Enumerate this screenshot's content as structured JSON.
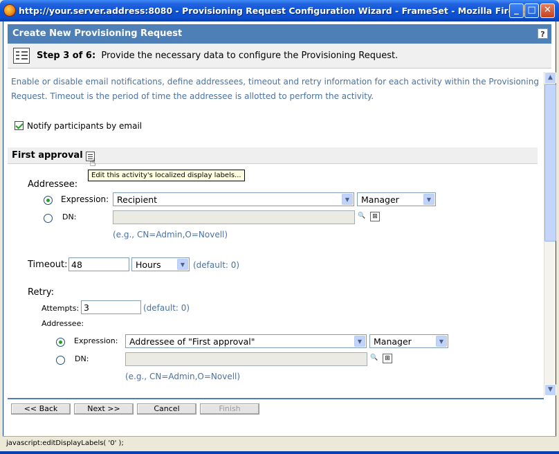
{
  "window": {
    "title": "http://your.server.address:8080 - Provisioning Request Configuration Wizard - FrameSet - Mozilla Firefox",
    "title_host": "http://your.server.address:8080",
    "title_rest": " - Provisioning Request Configuration Wizard - FrameSet - Mozilla Firefox",
    "minimize": "_",
    "maximize": "□",
    "close": "✕"
  },
  "header": {
    "title": "Create New Provisioning Request",
    "help": "?"
  },
  "step": {
    "label": "Step 3 of 6:",
    "text": "Provide the necessary data to configure the Provisioning Request."
  },
  "description": "Enable or disable email notifications, define addressees, timeout and retry information for each activity within the Provisioning Request.  Timeout is the period of time the addressee is allotted to perform the activity.",
  "notify": {
    "label": "Notify participants by email",
    "checked": true
  },
  "activity": {
    "name": "First approval",
    "tooltip": "Edit this activity's localized display labels...",
    "addressee": {
      "heading": "Addressee:",
      "expression_label": "Expression:",
      "expression_value": "Recipient",
      "relationship_value": "Manager",
      "dn_label": "DN:",
      "dn_value": "",
      "hint": "(e.g., CN=Admin,O=Novell)"
    },
    "timeout": {
      "label": "Timeout:",
      "value": "48",
      "unit": "Hours",
      "default": "(default: 0)"
    },
    "retry": {
      "heading": "Retry:",
      "attempts_label": "Attempts:",
      "attempts_value": "3",
      "attempts_default": "(default: 0)",
      "addressee_label": "Addressee:",
      "expression_label": "Expression:",
      "expression_value": "Addressee of \"First approval\"",
      "relationship_value": "Manager",
      "dn_label": "DN:",
      "dn_value": "",
      "hint": "(e.g., CN=Admin,O=Novell)"
    }
  },
  "buttons": {
    "back": "<< Back",
    "next": "Next >>",
    "cancel": "Cancel",
    "finish": "Finish"
  },
  "status": "javascript:editDisplayLabels( '0' );",
  "colors": {
    "accent": "#4e7fb7",
    "hint_text": "#4a72a2",
    "titlebar": "#0b55d8"
  }
}
